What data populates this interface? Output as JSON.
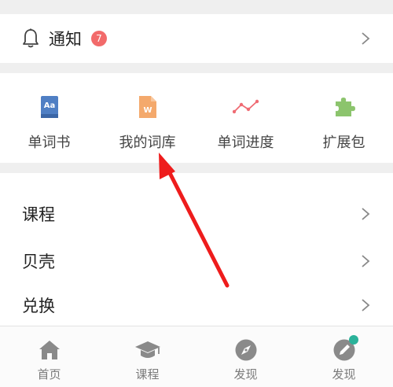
{
  "notice": {
    "label": "通知",
    "badge": "7"
  },
  "tools": [
    {
      "label": "单词书",
      "icon": "book-icon"
    },
    {
      "label": "我的词库",
      "icon": "word-file-icon"
    },
    {
      "label": "单词进度",
      "icon": "progress-line-icon"
    },
    {
      "label": "扩展包",
      "icon": "puzzle-icon"
    }
  ],
  "menu": [
    {
      "label": "课程"
    },
    {
      "label": "贝壳"
    },
    {
      "label": "兑换"
    }
  ],
  "tabbar": [
    {
      "label": "首页",
      "icon": "home-icon"
    },
    {
      "label": "课程",
      "icon": "graduation-cap-icon"
    },
    {
      "label": "发现",
      "icon": "compass-icon"
    },
    {
      "label": "发现",
      "icon": "profile-pen-icon"
    }
  ],
  "colors": {
    "badge": "#f26a6a",
    "annotation_arrow": "#ee1c1c",
    "tab_dot": "#2bb29a"
  }
}
